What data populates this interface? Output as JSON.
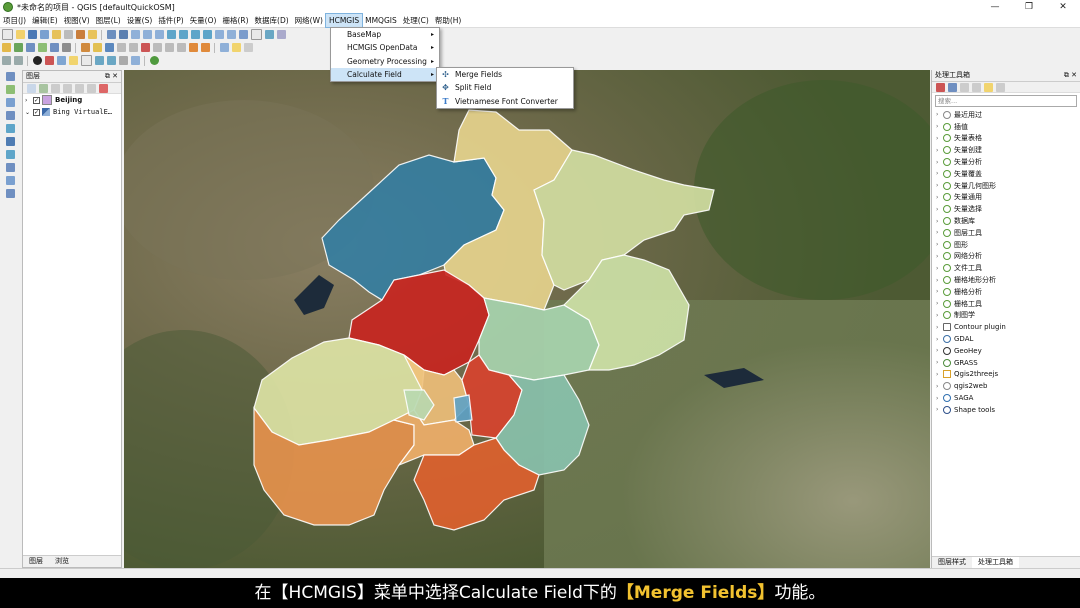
{
  "window": {
    "title": "*未命名的项目 - QGIS [defaultQuickOSM]",
    "controls": [
      "—",
      "❐",
      "✕"
    ]
  },
  "menubar": [
    {
      "label": "项目(J)"
    },
    {
      "label": "编辑(E)"
    },
    {
      "label": "视图(V)"
    },
    {
      "label": "图层(L)"
    },
    {
      "label": "设置(S)"
    },
    {
      "label": "插件(P)"
    },
    {
      "label": "矢量(O)"
    },
    {
      "label": "栅格(R)"
    },
    {
      "label": "数据库(D)"
    },
    {
      "label": "网络(W)"
    },
    {
      "label": "HCMGIS",
      "active": true
    },
    {
      "label": "MMQGIS"
    },
    {
      "label": "处理(C)"
    },
    {
      "label": "帮助(H)"
    }
  ],
  "hcmgis_menu": [
    {
      "label": "BaseMap",
      "has_submenu": true
    },
    {
      "label": "HCMGIS OpenData",
      "has_submenu": true
    },
    {
      "label": "Geometry Processing",
      "has_submenu": true
    },
    {
      "label": "Calculate Field",
      "has_submenu": true,
      "active": true
    }
  ],
  "calculate_field_submenu": [
    {
      "label": "Merge Fields",
      "icon": "merge-fields-icon",
      "glyph": "✣"
    },
    {
      "label": "Split Field",
      "icon": "split-field-icon",
      "glyph": "✥"
    },
    {
      "label": "Vietnamese Font Converter",
      "icon": "font-converter-icon",
      "glyph": "T"
    }
  ],
  "layers_panel": {
    "title": "图层",
    "layers": [
      {
        "name": "Beijing",
        "checked": true,
        "bold": true,
        "icon": "polygon-layer-icon"
      },
      {
        "name": "Bing VirtualE…",
        "checked": true,
        "bold": false,
        "icon": "raster-layer-icon"
      }
    ],
    "tabs": [
      "图层",
      "浏览"
    ]
  },
  "processing_panel": {
    "title": "处理工具箱",
    "search_placeholder": "搜索...",
    "items": [
      {
        "label": "最近用过",
        "icon": "clock-icon"
      },
      {
        "label": "插值",
        "icon": "qgis-icon"
      },
      {
        "label": "矢量表格",
        "icon": "qgis-icon"
      },
      {
        "label": "矢量创建",
        "icon": "qgis-icon"
      },
      {
        "label": "矢量分析",
        "icon": "qgis-icon"
      },
      {
        "label": "矢量覆盖",
        "icon": "qgis-icon"
      },
      {
        "label": "矢量几何图形",
        "icon": "qgis-icon"
      },
      {
        "label": "矢量通用",
        "icon": "qgis-icon"
      },
      {
        "label": "矢量选择",
        "icon": "qgis-icon"
      },
      {
        "label": "数据库",
        "icon": "qgis-icon"
      },
      {
        "label": "图层工具",
        "icon": "qgis-icon"
      },
      {
        "label": "图形",
        "icon": "qgis-icon"
      },
      {
        "label": "网络分析",
        "icon": "qgis-icon"
      },
      {
        "label": "文件工具",
        "icon": "qgis-icon"
      },
      {
        "label": "栅格地形分析",
        "icon": "qgis-icon"
      },
      {
        "label": "栅格分析",
        "icon": "qgis-icon"
      },
      {
        "label": "栅格工具",
        "icon": "qgis-icon"
      },
      {
        "label": "制图学",
        "icon": "qgis-icon"
      },
      {
        "label": "Contour plugin",
        "icon": "contour-plugin-icon"
      },
      {
        "label": "GDAL",
        "icon": "gdal-icon"
      },
      {
        "label": "GeoHey",
        "icon": "geohey-icon"
      },
      {
        "label": "GRASS",
        "icon": "grass-icon"
      },
      {
        "label": "Qgis2threejs",
        "icon": "qgis2threejs-icon"
      },
      {
        "label": "qgis2web",
        "icon": "qgis2web-icon"
      },
      {
        "label": "SAGA",
        "icon": "saga-icon"
      },
      {
        "label": "Shape tools",
        "icon": "shape-tools-icon"
      }
    ],
    "tabs": [
      "图层样式",
      "处理工具箱"
    ]
  },
  "map": {
    "districts": [
      {
        "name": "yanqing",
        "color": "#2f7ea6"
      },
      {
        "name": "huairou",
        "color": "#e8d58e"
      },
      {
        "name": "miyun",
        "color": "#d4e0a3"
      },
      {
        "name": "changping",
        "color": "#c9231f"
      },
      {
        "name": "shunyi",
        "color": "#a9d6b0"
      },
      {
        "name": "pinggu",
        "color": "#cfe3a9"
      },
      {
        "name": "mentougou",
        "color": "#dfe6a6"
      },
      {
        "name": "haidian",
        "color": "#f0c07a"
      },
      {
        "name": "chaoyang",
        "color": "#d9422d"
      },
      {
        "name": "tongzhou",
        "color": "#89c3ae"
      },
      {
        "name": "fangshan",
        "color": "#e8924c"
      },
      {
        "name": "fengtai",
        "color": "#f2b06a"
      },
      {
        "name": "shijingshan",
        "color": "#b8d8b0"
      },
      {
        "name": "dongcheng",
        "color": "#5ea2c6"
      },
      {
        "name": "daxing",
        "color": "#e0602e"
      }
    ]
  },
  "subtitle": {
    "prefix": "在【HCMGIS】菜单中选择Calculate Field下的",
    "highlight": "【Merge Fields】",
    "suffix": "功能。"
  }
}
